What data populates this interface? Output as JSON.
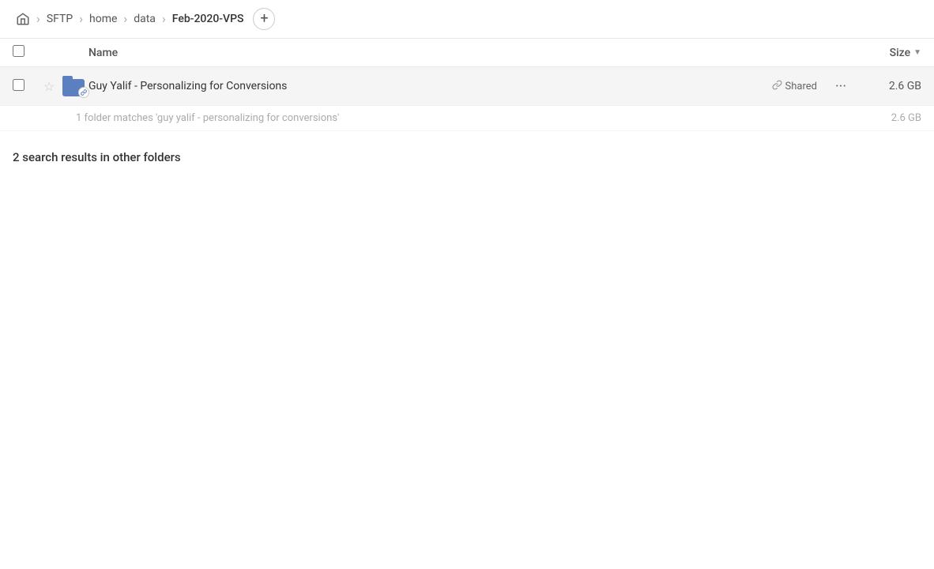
{
  "breadcrumb": {
    "home_icon": "⌂",
    "items": [
      "SFTP",
      "home",
      "data",
      "Feb-2020-VPS"
    ],
    "add_label": "+"
  },
  "table": {
    "col_name_label": "Name",
    "col_size_label": "Size",
    "sort_arrow": "▼"
  },
  "file_row": {
    "name": "Guy Yalif - Personalizing for Conversions",
    "shared_label": "Shared",
    "size": "2.6 GB",
    "more_icon": "···"
  },
  "match_info": {
    "text": "1 folder matches 'guy yalif - personalizing for conversions'",
    "size": "2.6 GB"
  },
  "other_folders": {
    "heading": "2 search results in other folders"
  }
}
